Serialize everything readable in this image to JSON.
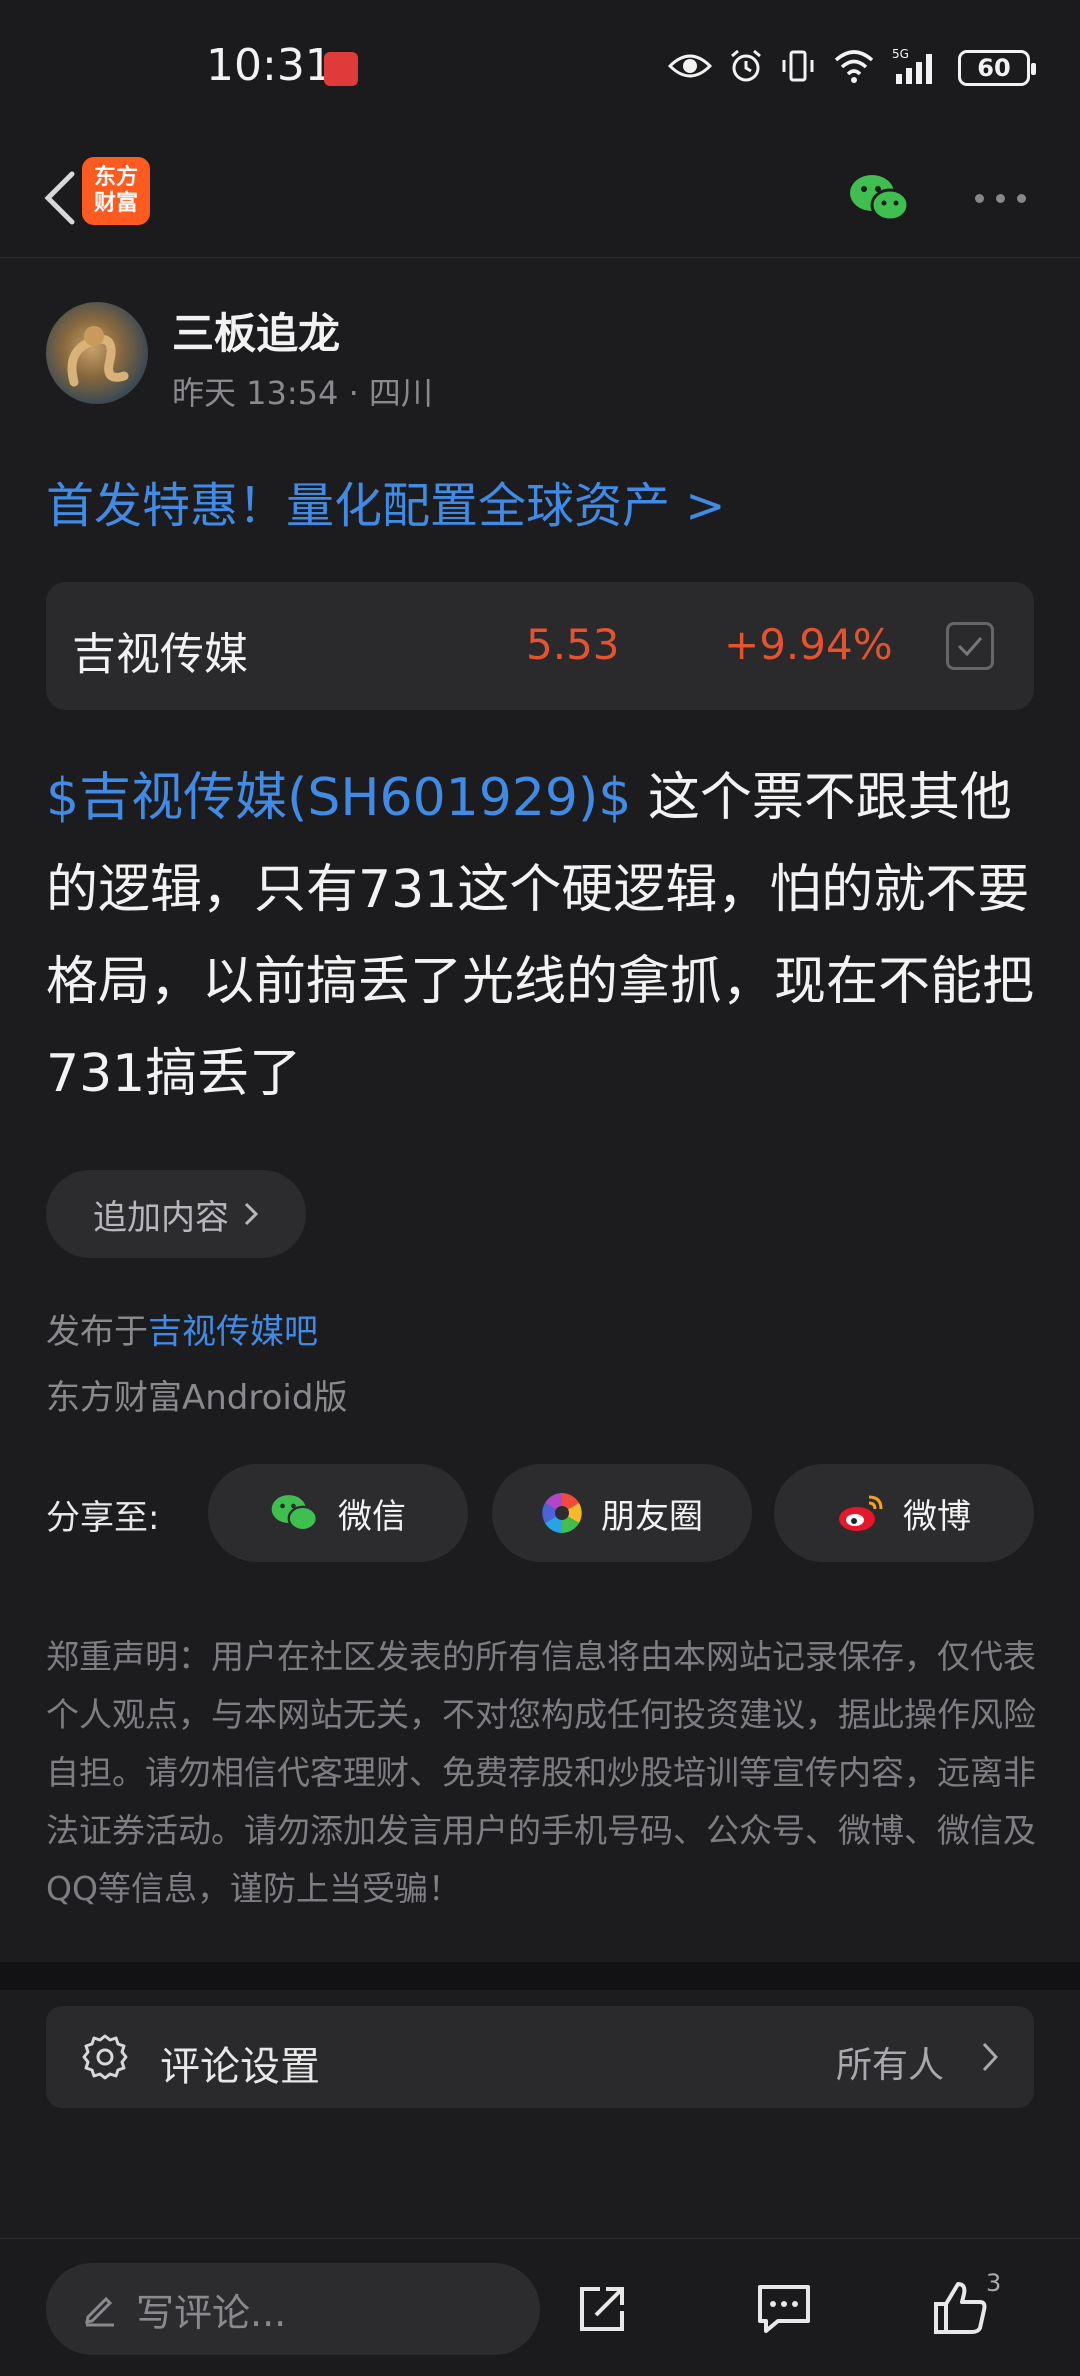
{
  "status_bar": {
    "time": "10:31",
    "battery": "60",
    "network": "5G",
    "sim": "6"
  },
  "header": {
    "app_logo_line1": "东方",
    "app_logo_line2": "财富"
  },
  "author": {
    "name": "三板追龙",
    "meta": "昨天 13:54 · 四川"
  },
  "promo": {
    "text": "首发特惠！量化配置全球资产 >"
  },
  "stock": {
    "name": "吉视传媒",
    "price": "5.53",
    "change": "+9.94%",
    "price_color": "#e5522e"
  },
  "post": {
    "stock_tag": "$吉视传媒(SH601929)$",
    "text": " 这个票不跟其他的逻辑，只有731这个硬逻辑，怕的就不要格局，以前搞丢了光线的拿抓，现在不能把731搞丢了"
  },
  "append": {
    "label": "追加内容"
  },
  "published": {
    "prefix": "发布于",
    "bar_name": "吉视传媒吧",
    "platform": "东方财富Android版"
  },
  "share": {
    "label": "分享至:",
    "wechat": "微信",
    "moments": "朋友圈",
    "weibo": "微博"
  },
  "disclaimer": "郑重声明：用户在社区发表的所有信息将由本网站记录保存，仅代表个人观点，与本网站无关，不对您构成任何投资建议，据此操作风险自担。请勿相信代客理财、免费荐股和炒股培训等宣传内容，远离非法证券活动。请勿添加发言用户的手机号码、公众号、微博、微信及QQ等信息，谨防上当受骗！",
  "comment_settings": {
    "label": "评论设置",
    "value": "所有人"
  },
  "bottom_bar": {
    "comment_placeholder": "写评论...",
    "like_count": "3"
  },
  "colors": {
    "accent": "#3f8be6",
    "up": "#e5522e",
    "wechat": "#3fbf4f"
  }
}
